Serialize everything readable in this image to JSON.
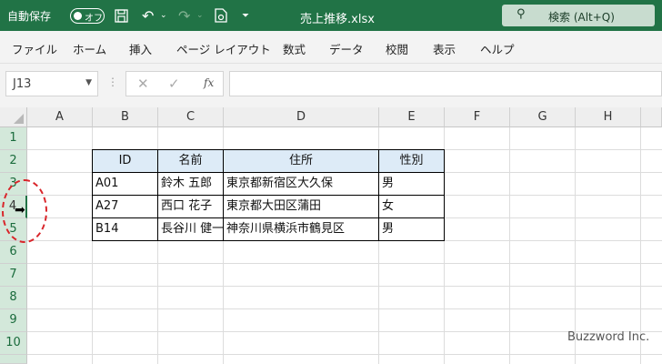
{
  "titlebar": {
    "autosave_label": "自動保存",
    "autosave_state": "オフ",
    "doc_title": "売上推移.xlsx",
    "search_placeholder": "検索 (Alt+Q)",
    "bg_color": "#217346"
  },
  "ribbon": {
    "tabs": [
      "ファイル",
      "ホーム",
      "挿入",
      "ページ レイアウト",
      "数式",
      "データ",
      "校閲",
      "表示",
      "ヘルプ"
    ]
  },
  "formula_bar": {
    "name_box": "J13",
    "fx_label": "fx",
    "formula_value": ""
  },
  "grid": {
    "columns": [
      "A",
      "B",
      "C",
      "D",
      "E",
      "F",
      "G",
      "H"
    ],
    "rows": [
      "1",
      "2",
      "3",
      "4",
      "5",
      "6",
      "7",
      "8",
      "9",
      "10"
    ],
    "selected_row": "4"
  },
  "table": {
    "headers": [
      "ID",
      "名前",
      "住所",
      "性別"
    ],
    "rows": [
      [
        "A01",
        "鈴木 五郎",
        "東京都新宿区大久保",
        "男"
      ],
      [
        "A27",
        "西口 花子",
        "東京都大田区蒲田",
        "女"
      ],
      [
        "B14",
        "長谷川 健一",
        "神奈川県横浜市鶴見区",
        "男"
      ]
    ],
    "header_fill": "#ddebf7"
  },
  "annotation": {
    "circle_color": "#d9252a",
    "watermark": "Buzzword Inc."
  }
}
